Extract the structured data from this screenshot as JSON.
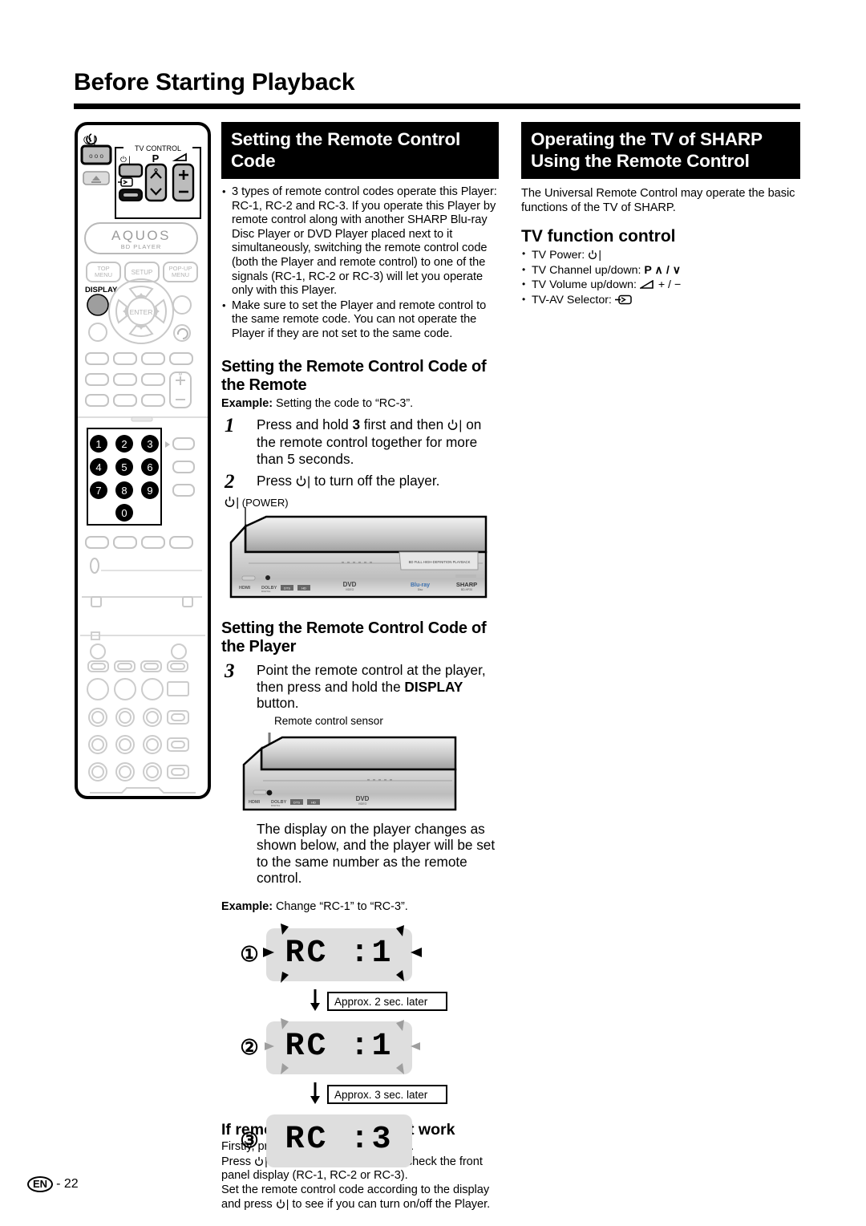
{
  "page": {
    "title": "Before Starting Playback",
    "footer_locale": "EN",
    "footer_page": "- 22"
  },
  "remote_illustration": {
    "tv_control_label": "TV CONTROL",
    "p_label": "P",
    "brand": "AQUOS",
    "brand_sub": "BD PLAYER",
    "buttons": {
      "top_menu": "TOP\nMENU",
      "setup": "SETUP",
      "pop_up_menu": "POP-UP\nMENU",
      "display": "DISPLAY",
      "enter": "ENTER"
    },
    "keypad": [
      "1",
      "2",
      "3",
      "4",
      "5",
      "6",
      "7",
      "8",
      "9",
      "0"
    ]
  },
  "section_remote_code": {
    "heading": "Setting the Remote Control Code",
    "bullets": [
      "3 types of remote control codes operate this Player: RC-1, RC-2 and RC-3. If you operate this Player by remote control along with another SHARP Blu-ray Disc Player or DVD Player placed next to it simultaneously, switching the remote control code (both the Player and remote control) to one of the signals (RC-1, RC-2 or RC-3) will let you operate only with this Player.",
      "Make sure to set the Player and remote control to the same remote code. You can not operate the Player if they are not set to the same code."
    ]
  },
  "section_code_of_remote": {
    "heading": "Setting the Remote Control Code of the Remote",
    "example_label": "Example:",
    "example_text": "Setting the code to “RC-3”.",
    "steps": [
      {
        "num": "1",
        "text_before": "Press and hold ",
        "bold": "3",
        "text_mid": " first and then ",
        "icon": "power-icon",
        "text_after": " on the remote control together for more than 5 seconds."
      },
      {
        "num": "2",
        "text_before": "Press ",
        "icon": "power-icon",
        "text_after": " to turn off the player."
      }
    ],
    "power_caption": "(POWER)"
  },
  "section_code_of_player": {
    "heading": "Setting the Remote Control Code of the Player",
    "step": {
      "num": "3",
      "text_before": "Point the remote control at the player, then press and hold the ",
      "bold": "DISPLAY",
      "text_after": " button."
    },
    "sensor_callout": "Remote control sensor",
    "result_text": "The display on the player changes as shown below, and the player will be set to the same number as the remote control.",
    "example_label": "Example:",
    "example_text": "Change “RC-1” to “RC-3”."
  },
  "rc_sequence": [
    {
      "num": "①",
      "display": "RC :1",
      "blink": "strong",
      "note": "Approx. 2 sec. later"
    },
    {
      "num": "②",
      "display": "RC :1",
      "blink": "light",
      "note": "Approx. 3 sec. later"
    },
    {
      "num": "③",
      "display": "RC :3",
      "blink": "none",
      "note": ""
    }
  ],
  "section_not_work": {
    "heading": "If remote control does not work",
    "lines": [
      {
        "a": "Firstly, press ",
        "icon": "power-icon",
        "b": " to turn on this player."
      },
      {
        "a": "Press ",
        "icon": "power-icon",
        "b": " on the remote control and check the front panel display (RC-1, RC-2 or RC-3)."
      },
      {
        "a": "Set the remote control code according to the display and press ",
        "icon": "power-icon",
        "b": " to see if you can turn on/off the Player."
      }
    ]
  },
  "section_operating_tv": {
    "heading": "Operating the TV of SHARP Using the Remote Control",
    "intro": "The Universal Remote Control may operate the basic functions of the TV of SHARP.",
    "sub_heading": "TV function control",
    "items": [
      {
        "label": "TV Power:",
        "icon": "power-icon"
      },
      {
        "label": "TV Channel up/down:",
        "icon": "channel-up-down-icon",
        "glyph": "P ∧ / ∨"
      },
      {
        "label": "TV Volume up/down:",
        "icon": "volume-icon",
        "glyph": "+ / −"
      },
      {
        "label": "TV-AV Selector:",
        "icon": "av-input-icon"
      }
    ]
  },
  "device_front_panel": {
    "badge": "BD FULL HIGH-DEFINITION PLAYBACK",
    "logos": [
      "HDMI",
      "Dolby",
      "DTS",
      "DVD",
      "Blu-ray Disc",
      "SHARP"
    ]
  },
  "colors": {
    "ink": "#000000",
    "paper": "#ffffff",
    "lcd": "#dedede",
    "button_gray": "#b6b6b6"
  }
}
